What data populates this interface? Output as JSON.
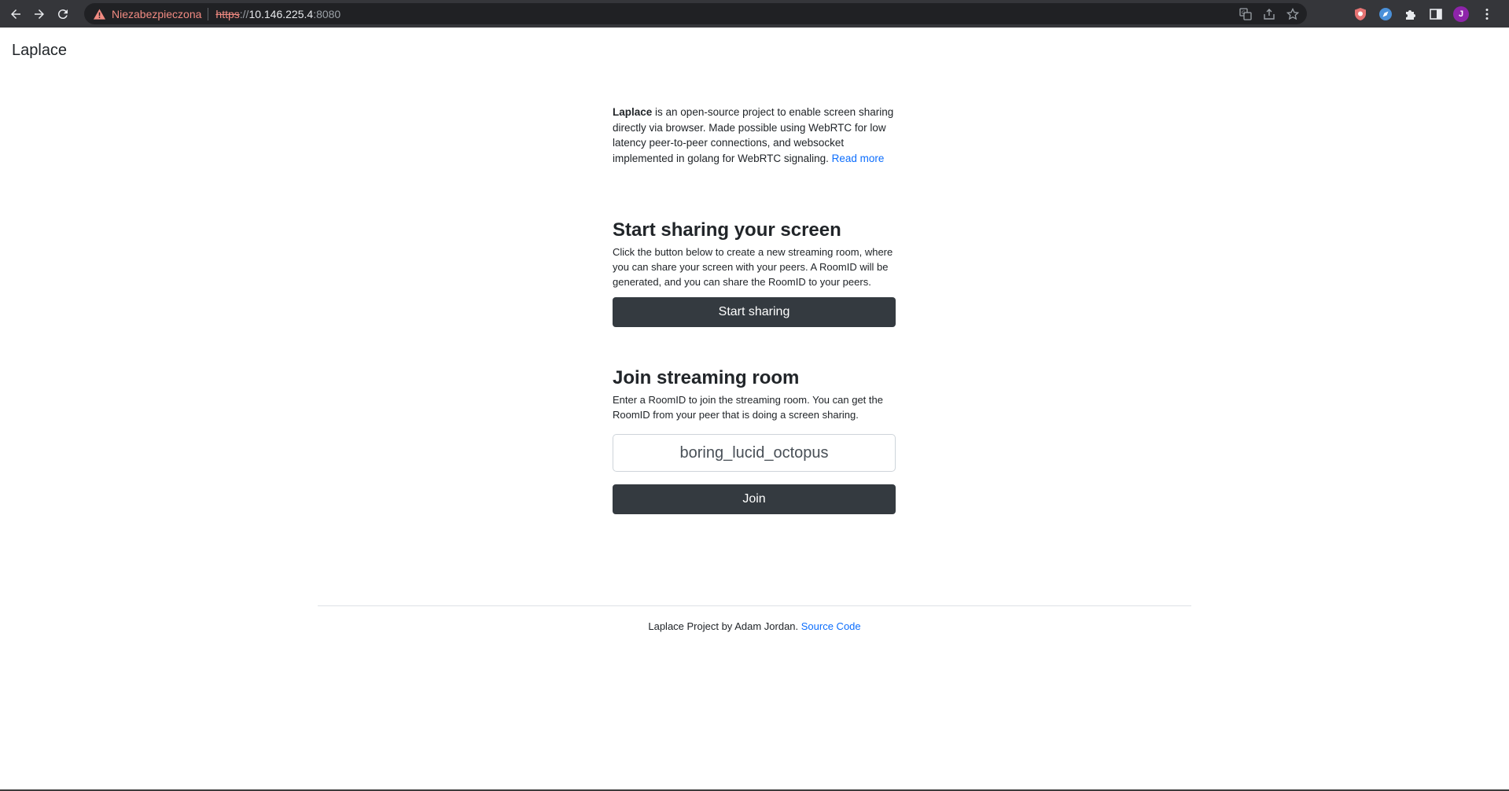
{
  "browser": {
    "security_label": "Niezabezpieczona",
    "url_scheme": "https",
    "url_separator": "://",
    "url_host": "10.146.225.4",
    "url_port": ":8080",
    "avatar_initial": "J",
    "avatar_color": "#8e24aa"
  },
  "navbar": {
    "brand": "Laplace"
  },
  "intro": {
    "bold": "Laplace",
    "text": " is an open-source project to enable screen sharing directly via browser. Made possible using WebRTC for low latency peer-to-peer connections, and websocket implemented in golang for WebRTC signaling. ",
    "link": "Read more"
  },
  "share": {
    "title": "Start sharing your screen",
    "description": "Click the button below to create a new streaming room, where you can share your screen with your peers. A RoomID will be generated, and you can share the RoomID to your peers.",
    "button": "Start sharing"
  },
  "join": {
    "title": "Join streaming room",
    "description": "Enter a RoomID to join the streaming room. You can get the RoomID from your peer that is doing a screen sharing.",
    "room_id_value": "boring_lucid_octopus",
    "button": "Join"
  },
  "footer": {
    "text": "Laplace Project by Adam Jordan. ",
    "link": "Source Code"
  },
  "colors": {
    "button_bg": "#343a40",
    "link": "#0d6efd",
    "chrome_bg": "#35363a"
  }
}
